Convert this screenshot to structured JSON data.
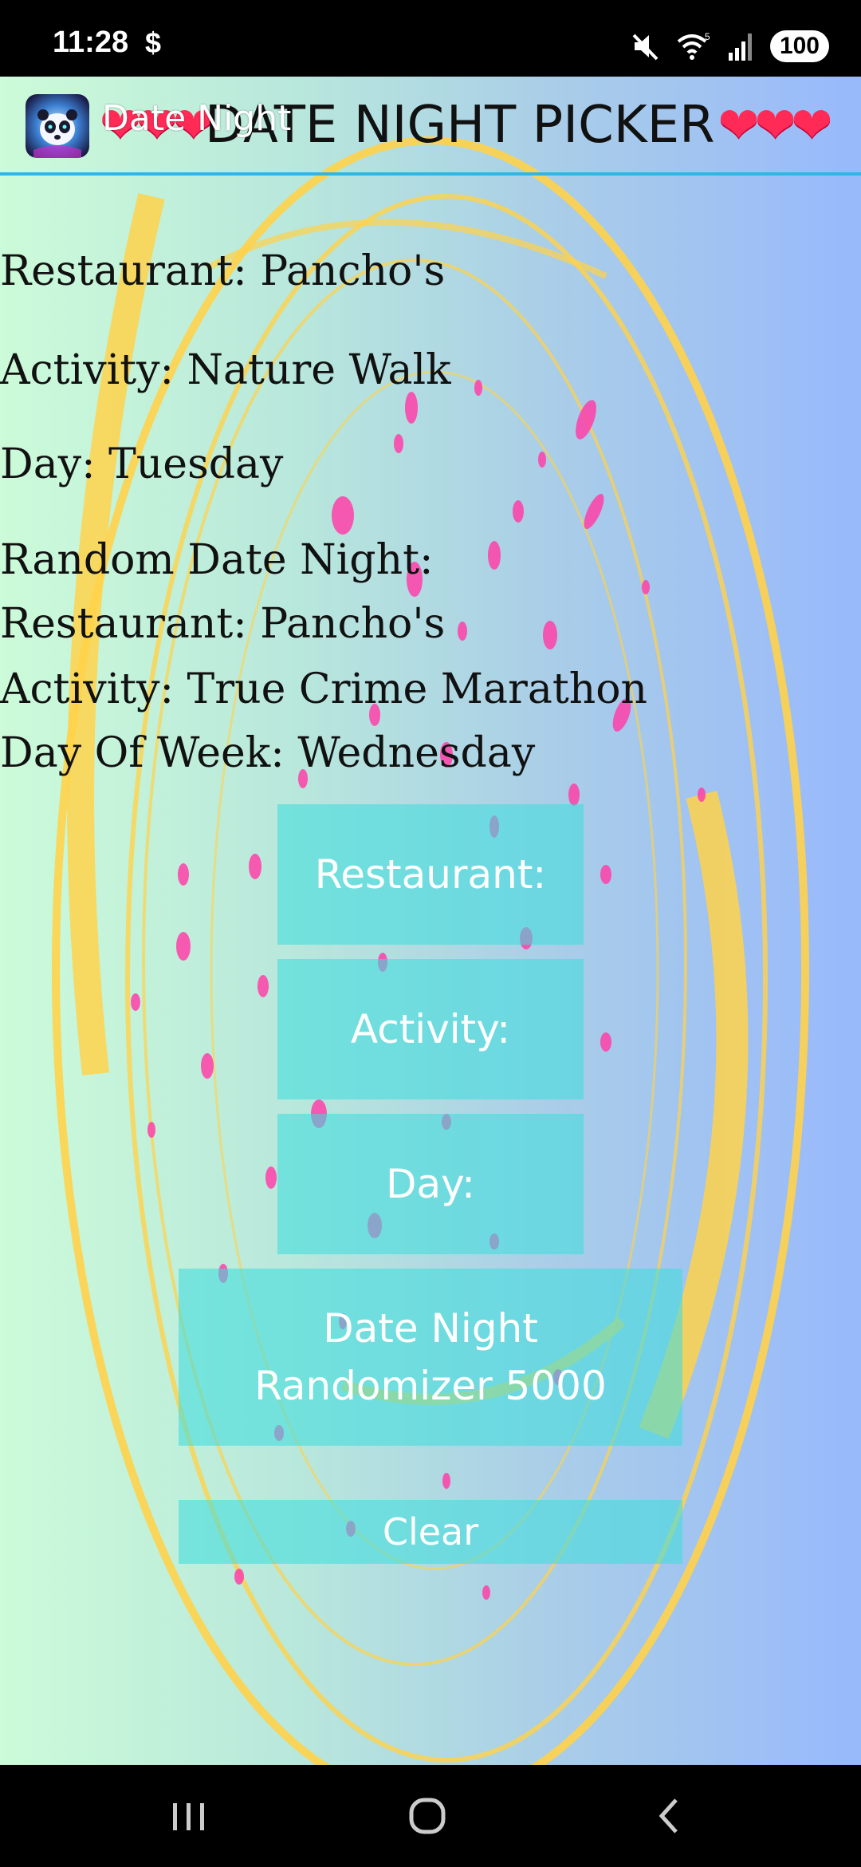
{
  "status_bar": {
    "time": "11:28",
    "dollar_icon": "$",
    "battery": "100",
    "icons": [
      "mute-icon",
      "wifi-icon",
      "signal-icon",
      "battery-icon"
    ]
  },
  "header": {
    "app_label": "Date Night",
    "hearts_left": "❤❤❤",
    "title": "DATE NIGHT PICKER",
    "hearts_right": "❤❤❤"
  },
  "results": {
    "restaurant": "Restaurant: Pancho's",
    "activity": "Activity: Nature Walk",
    "day": "Day: Tuesday",
    "random_heading": "Random Date Night:",
    "random_restaurant": "Restaurant: Pancho's",
    "random_activity": "Activity: True Crime Marathon",
    "random_day": "Day Of Week: Wednesday"
  },
  "buttons": {
    "restaurant": "Restaurant:",
    "activity": "Activity:",
    "day": "Day:",
    "randomizer": "Date Night Randomizer 5000",
    "clear": "Clear"
  },
  "nav": {
    "icons": [
      "recents-icon",
      "home-icon",
      "back-icon"
    ]
  },
  "colors": {
    "accent_line": "#33b4e5",
    "button_fill": "#40dcdc",
    "hearts": "#ff2a56",
    "splatter": "#ff3fa8",
    "rings": "#ffd24a"
  }
}
